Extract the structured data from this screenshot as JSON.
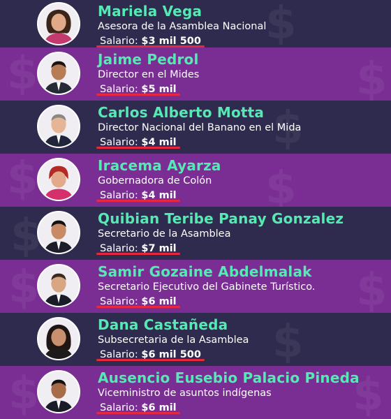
{
  "people": [
    {
      "name": "Mariela Vega",
      "role": "Asesora de la Asamblea Nacional",
      "salary_label": "Salario:",
      "salary_value": "$3 mil 500",
      "avatar": "woman-portrait-icon"
    },
    {
      "name": "Jaime Pedrol",
      "role": "Director en el Mides",
      "salary_label": "Salario:",
      "salary_value": "$5 mil",
      "avatar": "man-portrait-icon"
    },
    {
      "name": "Carlos Alberto Motta",
      "role": "Director Nacional del Banano en el Mida",
      "salary_label": "Salario:",
      "salary_value": "$4 mil",
      "avatar": "man-portrait-icon"
    },
    {
      "name": "Iracema Ayarza",
      "role": "Gobernadora de Colón",
      "salary_label": "Salario:",
      "salary_value": "$4 mil",
      "avatar": "woman-portrait-icon"
    },
    {
      "name": "Quibian Teribe Panay Gonzalez",
      "role": "Secretario de la Asamblea",
      "salary_label": "Salario:",
      "salary_value": "$7 mil",
      "avatar": "man-portrait-icon"
    },
    {
      "name": "Samir Gozaine Abdelmalak",
      "role": "Secretario Ejecutivo del Gabinete Turístico.",
      "salary_label": "Salario:",
      "salary_value": "$6 mil",
      "avatar": "man-portrait-icon"
    },
    {
      "name": "Dana Castañeda",
      "role": "Subsecretaria de la Asamblea",
      "salary_label": "Salario:",
      "salary_value": "$6 mil 500",
      "avatar": "woman-portrait-icon"
    },
    {
      "name": "Ausencio Eusebio Palacio Pineda",
      "role": "Viceministro de asuntos indígenas",
      "salary_label": "Salario:",
      "salary_value": "$6 mil",
      "avatar": "man-portrait-icon"
    }
  ],
  "colors": {
    "dark_row": "#2f2b4e",
    "purple_row": "#7a2e93",
    "name": "#55e9b3",
    "underline": "#e8283f"
  }
}
